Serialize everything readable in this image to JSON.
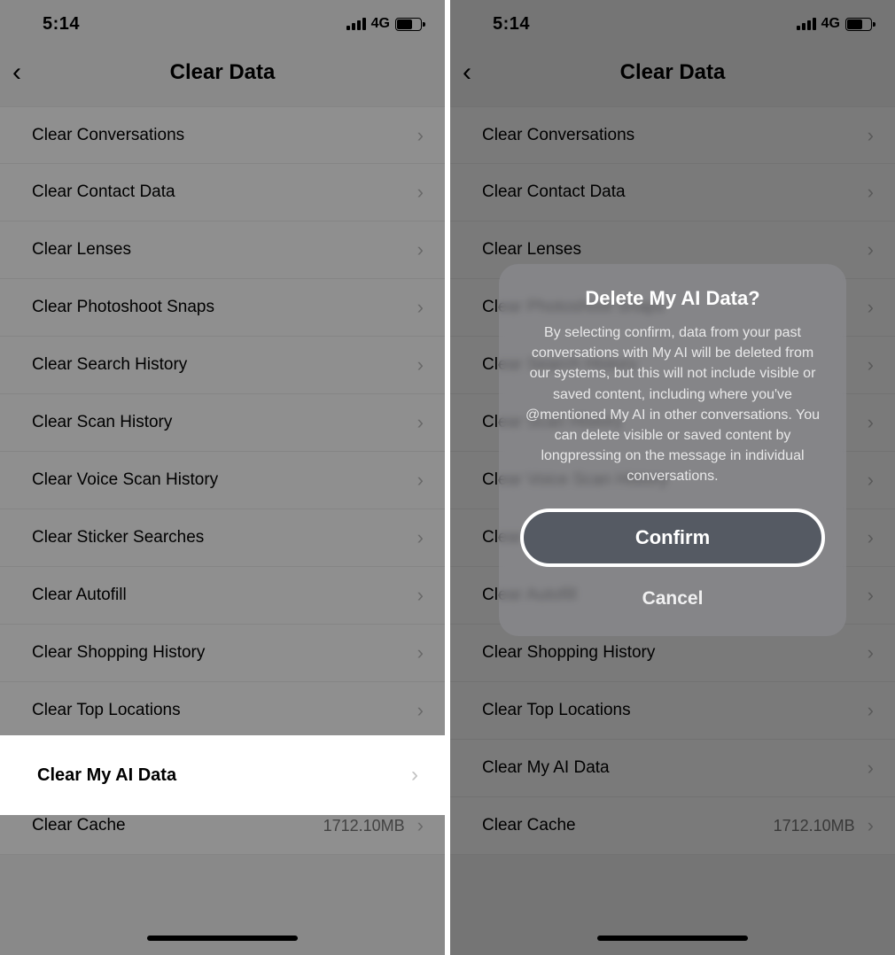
{
  "statusbar": {
    "time": "5:14",
    "network": "4G"
  },
  "nav": {
    "title": "Clear Data"
  },
  "rows": [
    {
      "label": "Clear Conversations"
    },
    {
      "label": "Clear Contact Data"
    },
    {
      "label": "Clear Lenses"
    },
    {
      "label": "Clear Photoshoot Snaps"
    },
    {
      "label": "Clear Search History"
    },
    {
      "label": "Clear Scan History"
    },
    {
      "label": "Clear Voice Scan History"
    },
    {
      "label": "Clear Sticker Searches"
    },
    {
      "label": "Clear Autofill"
    },
    {
      "label": "Clear Shopping History"
    },
    {
      "label": "Clear Top Locations"
    },
    {
      "label": "Clear My AI Data"
    },
    {
      "label": "Clear Cache",
      "value": "1712.10MB"
    }
  ],
  "highlight": {
    "label": "Clear My AI Data"
  },
  "modal": {
    "title": "Delete My AI Data?",
    "body": "By selecting confirm, data from your past conversations with My AI will be deleted from our systems, but this will not include visible or saved content, including where you've @mentioned My AI in other conversations. You can delete visible or saved content by longpressing on the message in individual conversations.",
    "confirm": "Confirm",
    "cancel": "Cancel"
  }
}
